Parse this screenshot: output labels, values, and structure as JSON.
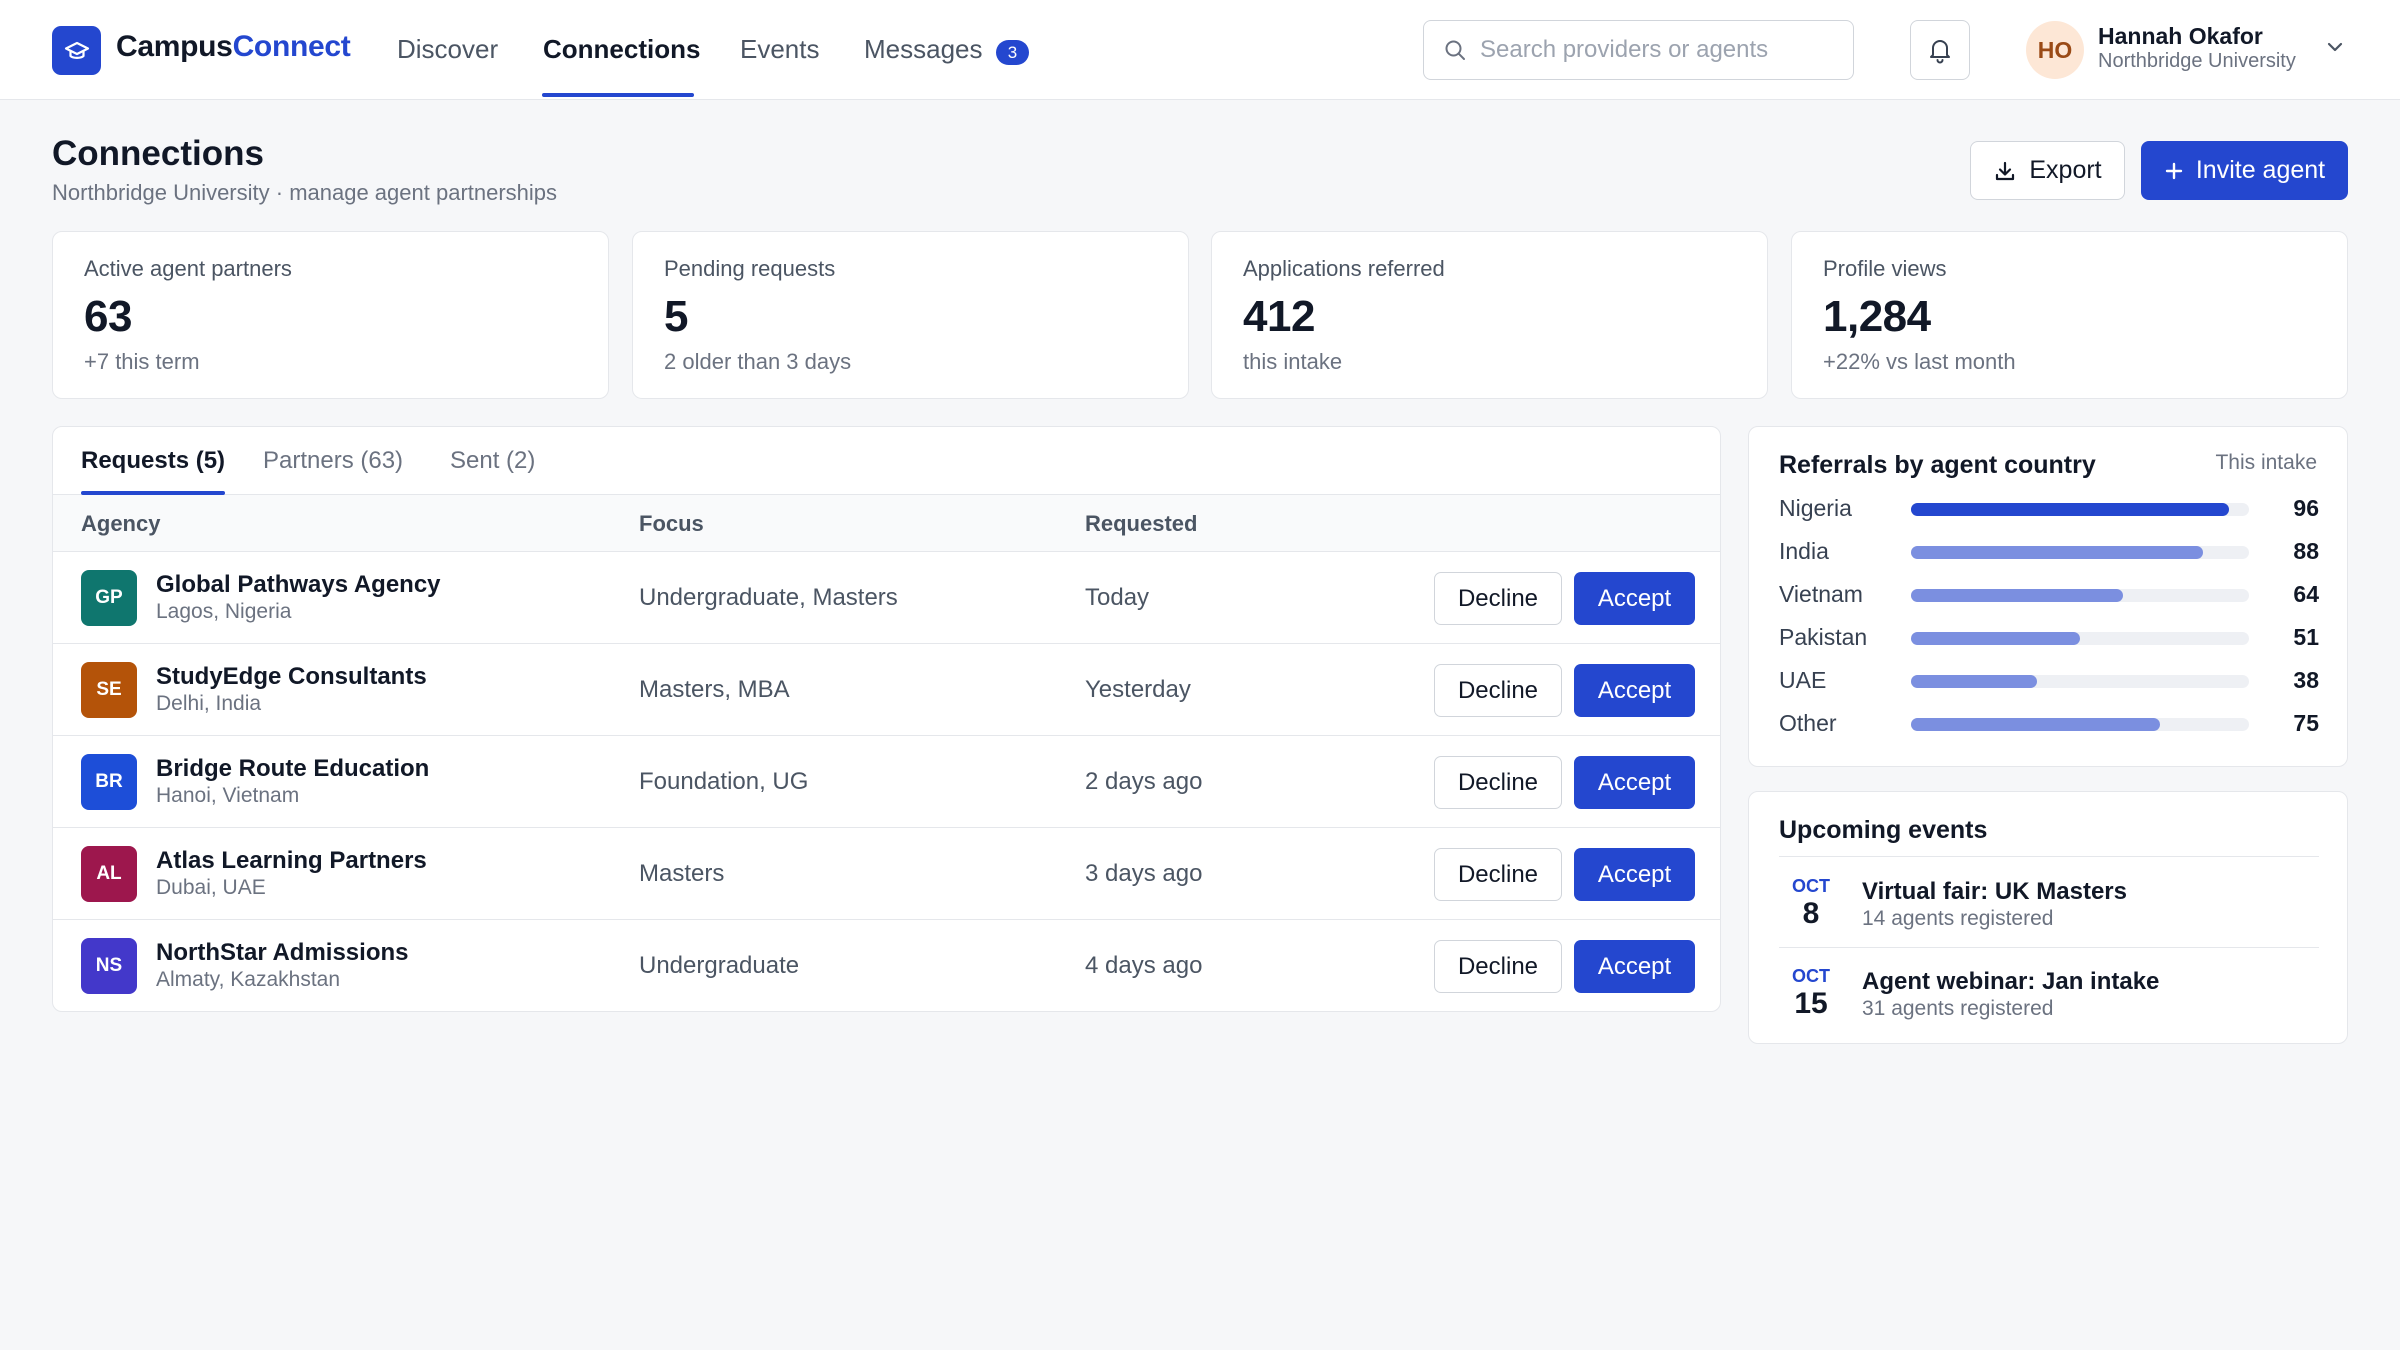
{
  "brand": {
    "name_part1": "Campus",
    "name_part2": "Connect"
  },
  "nav": {
    "links": [
      {
        "label": "Discover"
      },
      {
        "label": "Connections"
      },
      {
        "label": "Events"
      },
      {
        "label": "Messages"
      }
    ],
    "messages_badge": "3"
  },
  "search": {
    "placeholder": "Search providers or agents"
  },
  "user": {
    "initials": "HO",
    "name": "Hannah Okafor",
    "org": "Northbridge University"
  },
  "page": {
    "title": "Connections",
    "subtitle": "Northbridge University · manage agent partnerships"
  },
  "actions": {
    "export_label": "Export",
    "invite_label": "Invite agent"
  },
  "stats": [
    {
      "label": "Active agent partners",
      "value": "63",
      "delta": "+7 this term"
    },
    {
      "label": "Pending requests",
      "value": "5",
      "delta": "2 older than 3 days"
    },
    {
      "label": "Applications referred",
      "value": "412",
      "delta": "this intake"
    },
    {
      "label": "Profile views",
      "value": "1,284",
      "delta": "+22% vs last month"
    }
  ],
  "tabs": [
    {
      "label": "Requests (5)"
    },
    {
      "label": "Partners (63)"
    },
    {
      "label": "Sent (2)"
    }
  ],
  "table": {
    "headers": [
      "Agency",
      "Focus",
      "Requested"
    ],
    "decline_label": "Decline",
    "accept_label": "Accept",
    "rows": [
      {
        "initials": "GP",
        "color": "#0f766e",
        "name": "Global Pathways Agency",
        "location": "Lagos, Nigeria",
        "focus": "Undergraduate, Masters",
        "requested": "Today"
      },
      {
        "initials": "SE",
        "color": "#b45309",
        "name": "StudyEdge Consultants",
        "location": "Delhi, India",
        "focus": "Masters, MBA",
        "requested": "Yesterday"
      },
      {
        "initials": "BR",
        "color": "#1d4ed8",
        "name": "Bridge Route Education",
        "location": "Hanoi, Vietnam",
        "focus": "Foundation, UG",
        "requested": "2 days ago"
      },
      {
        "initials": "AL",
        "color": "#9d174d",
        "name": "Atlas Learning Partners",
        "location": "Dubai, UAE",
        "focus": "Masters",
        "requested": "3 days ago"
      },
      {
        "initials": "NS",
        "color": "#4338ca",
        "name": "NorthStar Admissions",
        "location": "Almaty, Kazakhstan",
        "focus": "Undergraduate",
        "requested": "4 days ago"
      }
    ]
  },
  "referrals": {
    "title": "Referrals by agent country",
    "period": "This intake",
    "max": 96,
    "primary_color": "#2447cf",
    "secondary_color": "#7b8fe0",
    "items": [
      {
        "country": "Nigeria",
        "value": 96
      },
      {
        "country": "India",
        "value": 88
      },
      {
        "country": "Vietnam",
        "value": 64
      },
      {
        "country": "Pakistan",
        "value": 51
      },
      {
        "country": "UAE",
        "value": 38
      },
      {
        "country": "Other",
        "value": 75
      }
    ]
  },
  "events": {
    "title": "Upcoming events",
    "items": [
      {
        "month": "OCT",
        "day": "8",
        "title": "Virtual fair: UK Masters",
        "subtitle": "14 agents registered"
      },
      {
        "month": "OCT",
        "day": "15",
        "title": "Agent webinar: Jan intake",
        "subtitle": "31 agents registered"
      }
    ]
  }
}
